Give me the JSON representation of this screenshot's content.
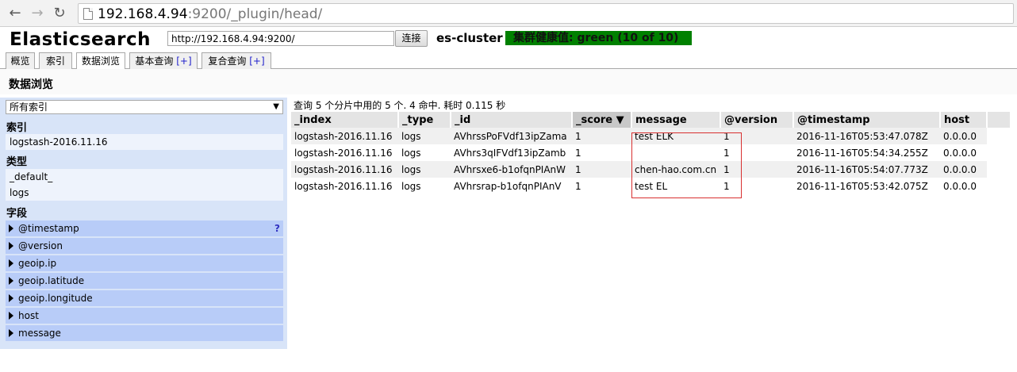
{
  "browser": {
    "url_host": "192.168.4.94",
    "url_rest": ":9200/_plugin/head/"
  },
  "header": {
    "title": "Elasticsearch",
    "server_url": "http://192.168.4.94:9200/",
    "connect_label": "连接",
    "cluster_name": "es-cluster",
    "health": "集群健康值: green (10 of 10)",
    "health_color": "#008000"
  },
  "tabs": [
    {
      "label": "概览"
    },
    {
      "label": "索引"
    },
    {
      "label": "数据浏览"
    },
    {
      "label": "基本查询",
      "extra": "[+]"
    },
    {
      "label": "复合查询",
      "extra": "[+]"
    }
  ],
  "active_tab": "数据浏览",
  "section_title": "数据浏览",
  "sidebar": {
    "index_select": "所有索引",
    "index_label": "索引",
    "indices": [
      "logstash-2016.11.16"
    ],
    "type_label": "类型",
    "types": [
      "_default_",
      "logs"
    ],
    "field_label": "字段",
    "fields": [
      "@timestamp",
      "@version",
      "geoip.ip",
      "geoip.latitude",
      "geoip.longitude",
      "host",
      "message"
    ],
    "help": "?"
  },
  "results": {
    "summary": "查询 5 个分片中用的 5 个. 4 命中. 耗时 0.115 秒",
    "columns": [
      "_index",
      "_type",
      "_id",
      "_score ▼",
      "message",
      "@version",
      "@timestamp",
      "host"
    ],
    "sorted_column": "_score ▼",
    "rows": [
      [
        "logstash-2016.11.16",
        "logs",
        "AVhrssPoFVdf13ipZama",
        "1",
        "test ELK",
        "1",
        "2016-11-16T05:53:47.078Z",
        "0.0.0.0"
      ],
      [
        "logstash-2016.11.16",
        "logs",
        "AVhrs3qIFVdf13ipZamb",
        "1",
        "",
        "1",
        "2016-11-16T05:54:34.255Z",
        "0.0.0.0"
      ],
      [
        "logstash-2016.11.16",
        "logs",
        "AVhrsxe6-b1ofqnPIAnW",
        "1",
        "chen-hao.com.cn",
        "1",
        "2016-11-16T05:54:07.773Z",
        "0.0.0.0"
      ],
      [
        "logstash-2016.11.16",
        "logs",
        "AVhrsrap-b1ofqnPIAnV",
        "1",
        "test EL",
        "1",
        "2016-11-16T05:53:42.075Z",
        "0.0.0.0"
      ]
    ]
  },
  "colors": {
    "sidebar_bg": "#d8e4f8",
    "field_bg": "#b8ccf8",
    "highlight": "#d83030"
  }
}
